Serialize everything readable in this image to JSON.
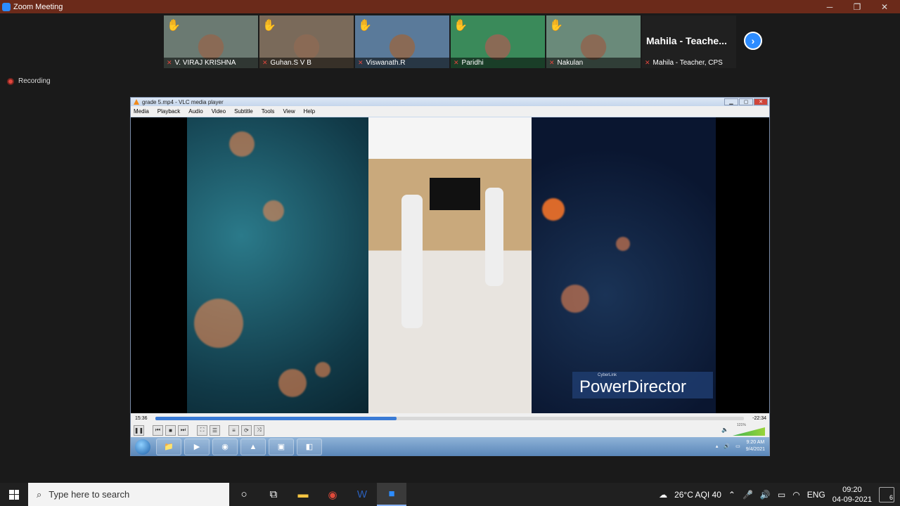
{
  "window": {
    "title": "Zoom Meeting",
    "min": "─",
    "max": "❐",
    "close": "✕"
  },
  "participants": [
    {
      "name": "V.  VIRAJ  KRISHNA",
      "color": "#6b7a72"
    },
    {
      "name": "Guhan.S V  B",
      "color": "#7a6a5a"
    },
    {
      "name": "Viswanath.R",
      "color": "#5a7a9a"
    },
    {
      "name": "Paridhi",
      "color": "#3a8a5a"
    },
    {
      "name": "Nakulan",
      "color": "#6a8a7a"
    }
  ],
  "teacher": {
    "big_name": "Mahila  -  Teache...",
    "name": "Mahila - Teacher, CPS"
  },
  "recording": "Recording",
  "vlc": {
    "title": "grade 5.mp4 - VLC media player",
    "menu": [
      "Media",
      "Playback",
      "Audio",
      "Video",
      "Subtitle",
      "Tools",
      "View",
      "Help"
    ],
    "elapsed": "15:36",
    "remaining": "-22:34",
    "progress_percent": 41,
    "volume": "121%",
    "logo_small": "CyberLink",
    "logo": "PowerDirector",
    "w7_time": "9:20 AM",
    "w7_date": "9/4/2021"
  },
  "taskbar": {
    "search_placeholder": "Type here to search",
    "weather": "26°C  AQI 40",
    "lang": "ENG",
    "time": "09:20",
    "date": "04-09-2021",
    "notifications": "6"
  }
}
